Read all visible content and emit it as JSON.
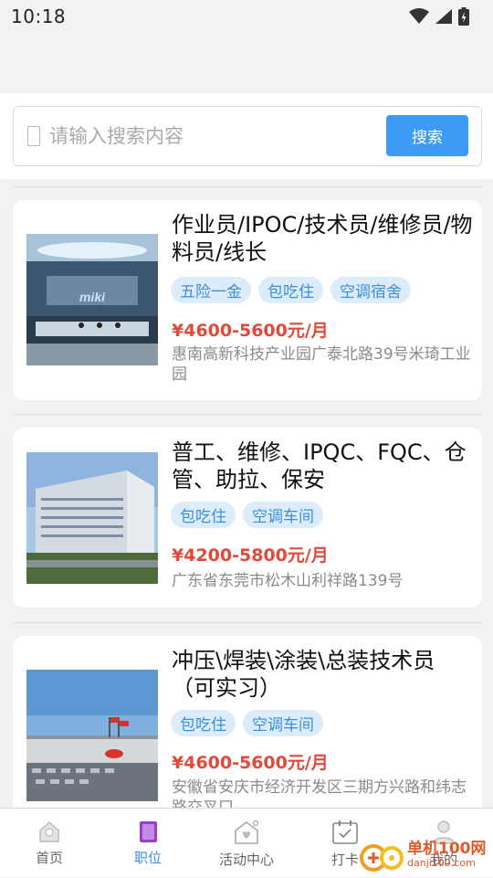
{
  "status_bar": {
    "time": "10:18"
  },
  "search": {
    "placeholder": "请输入搜索内容",
    "button_label": "搜索"
  },
  "jobs": [
    {
      "title": "作业员/IPOC/技术员/维修员/物料员/线长",
      "tags": [
        "五险一金",
        "包吃住",
        "空调宿舍"
      ],
      "salary": "¥4600-5600元/月",
      "address": "惠南高新科技产业园广泰北路39号米琦工业园",
      "image_logo_text": "miki"
    },
    {
      "title": "普工、维修、IPQC、FQC、仓管、助拉、保安",
      "tags": [
        "包吃住",
        "空调车间"
      ],
      "salary": "¥4200-5800元/月",
      "address": "广东省东莞市松木山利祥路139号"
    },
    {
      "title": "冲压\\焊装\\涂装\\总装技术员（可实习）",
      "tags": [
        "包吃住",
        "空调车间"
      ],
      "salary": "¥4600-5600元/月",
      "address": "安徽省安庆市经济开发区三期方兴路和纬志路交叉口"
    }
  ],
  "tabbar": {
    "active": "职位",
    "items": [
      {
        "label": "首页",
        "icon": "home-icon"
      },
      {
        "label": "职位",
        "icon": "job-icon"
      },
      {
        "label": "活动中心",
        "icon": "activity-icon"
      },
      {
        "label": "打卡",
        "icon": "calendar-check-icon"
      },
      {
        "label": "我的",
        "icon": "user-icon"
      }
    ]
  },
  "watermark": {
    "line1": "单机100网",
    "line2": "danji100.com"
  },
  "colors": {
    "accent": "#3d9bf5",
    "tag_bg": "#dcecfb",
    "tag_text": "#3b8fe0",
    "salary": "#e04a3a"
  }
}
